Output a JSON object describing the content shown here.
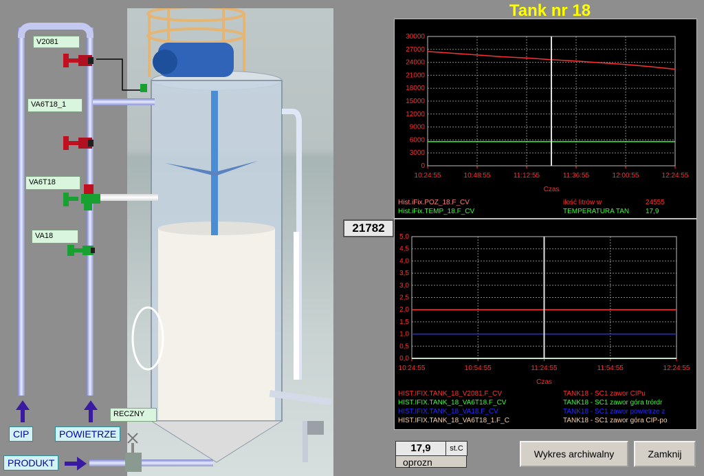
{
  "title": "Tank nr 18",
  "level_value": "21782",
  "temperature": {
    "value": "17,9",
    "unit": "st.C",
    "status": "oprozn"
  },
  "tags": {
    "v2081": "V2081",
    "va6t18_1": "VA6T18_1",
    "va6t18": "VA6T18",
    "va18": "VA18",
    "reczny": "RECZNY"
  },
  "nav": {
    "cip": "CIP",
    "powietrze": "POWIETRZE",
    "produkt": "PRODUKT"
  },
  "buttons": {
    "archive": "Wykres archiwalny",
    "close": "Zamknij"
  },
  "colors": {
    "title": "#ffff00",
    "series_red": "#ff3030",
    "series_green": "#33ff33",
    "series_blue": "#2a2aff",
    "series_white": "#ffffff"
  },
  "chart_data": [
    {
      "type": "line",
      "xlabel": "Czas",
      "ylim": [
        0,
        30000
      ],
      "yticks": [
        "0",
        "3000",
        "6000",
        "9000",
        "12000",
        "15000",
        "18000",
        "21000",
        "24000",
        "27000",
        "30000"
      ],
      "xticks": [
        "10:24:55",
        "10:48:55",
        "11:12:55",
        "11:36:55",
        "12:00:55",
        "12:24:55"
      ],
      "grid": true,
      "cursor_x": 0.5,
      "series": [
        {
          "name": "Hist.iFix.POZ_18.F_CV",
          "color": "#ff3030",
          "x": [
            0,
            0.1,
            0.2,
            0.3,
            0.4,
            0.5,
            0.6,
            0.7,
            0.8,
            0.9,
            1.0
          ],
          "values": [
            26500,
            26100,
            25700,
            25300,
            25000,
            24600,
            24300,
            23900,
            23500,
            23000,
            22400
          ]
        },
        {
          "name": "Hist.iFix.TEMP_18.F_CV",
          "color": "#33ff33",
          "x": [
            0,
            0.25,
            0.5,
            0.75,
            1.0
          ],
          "values": [
            5600,
            5600,
            5600,
            5600,
            5600
          ]
        }
      ],
      "legend": [
        {
          "tag": "Hist.iFix.POZ_18.F_CV",
          "desc": "ilość litrów w",
          "value": "24555",
          "tag_color": "#ff7f7f",
          "desc_color": "#ff3030"
        },
        {
          "tag": "Hist.iFix.TEMP_18.F_CV",
          "desc": "TEMPERATURA TAN",
          "value": "17,9",
          "tag_color": "#33ff33",
          "desc_color": "#33ff33"
        }
      ]
    },
    {
      "type": "line",
      "xlabel": "Czas",
      "ylim": [
        0,
        5
      ],
      "yticks": [
        "0,0",
        "0,5",
        "1,0",
        "1,5",
        "2,0",
        "2,5",
        "3,0",
        "3,5",
        "4,0",
        "4,5",
        "5,0"
      ],
      "xticks": [
        "10:24:55",
        "10:54:55",
        "11:24:55",
        "11:54:55",
        "12:24:55"
      ],
      "grid": true,
      "cursor_x": 0.5,
      "series": [
        {
          "name": "HIST.IFIX.TANK_18_V2081.F_CV",
          "color": "#ff3030",
          "x": [
            0,
            1
          ],
          "values": [
            2.0,
            2.0
          ]
        },
        {
          "name": "HIST.IFIX.TANK_18_VA6T18.F_CV",
          "color": "#33ff33",
          "x": [
            0,
            1
          ],
          "values": [
            0,
            0
          ]
        },
        {
          "name": "HIST.IFIX.TANK_18_VA18.F_CV",
          "color": "#2a2aff",
          "x": [
            0,
            1
          ],
          "values": [
            1.0,
            1.0
          ]
        },
        {
          "name": "HIST.IFIX.TANK_18_VA6T18_1.F_C",
          "color": "#ffffff",
          "x": [
            0,
            1
          ],
          "values": [
            0,
            0
          ]
        }
      ],
      "legend": [
        {
          "tag": "HIST.IFIX.TANK_18_V2081.F_CV",
          "desc": "TANK18 - SC1 zawor CIPu",
          "tag_color": "#ff3030",
          "desc_color": "#ff3030"
        },
        {
          "tag": "HIST.IFIX.TANK_18_VA6T18.F_CV",
          "desc": "TANK18 - SC1 zawor góra trórdr",
          "tag_color": "#33ff33",
          "desc_color": "#33ff33"
        },
        {
          "tag": "HIST.IFIX.TANK_18_VA18.F_CV",
          "desc": "TANK18 - SC1 zawor powietrze z",
          "tag_color": "#2a2aff",
          "desc_color": "#2a2aff"
        },
        {
          "tag": "HIST.IFIX.TANK_18_VA6T18_1.F_C",
          "desc": "TANK18 - SC1 zawor góra CIP-po",
          "tag_color": "#ffd0a0",
          "desc_color": "#ffd0a0"
        }
      ]
    }
  ]
}
